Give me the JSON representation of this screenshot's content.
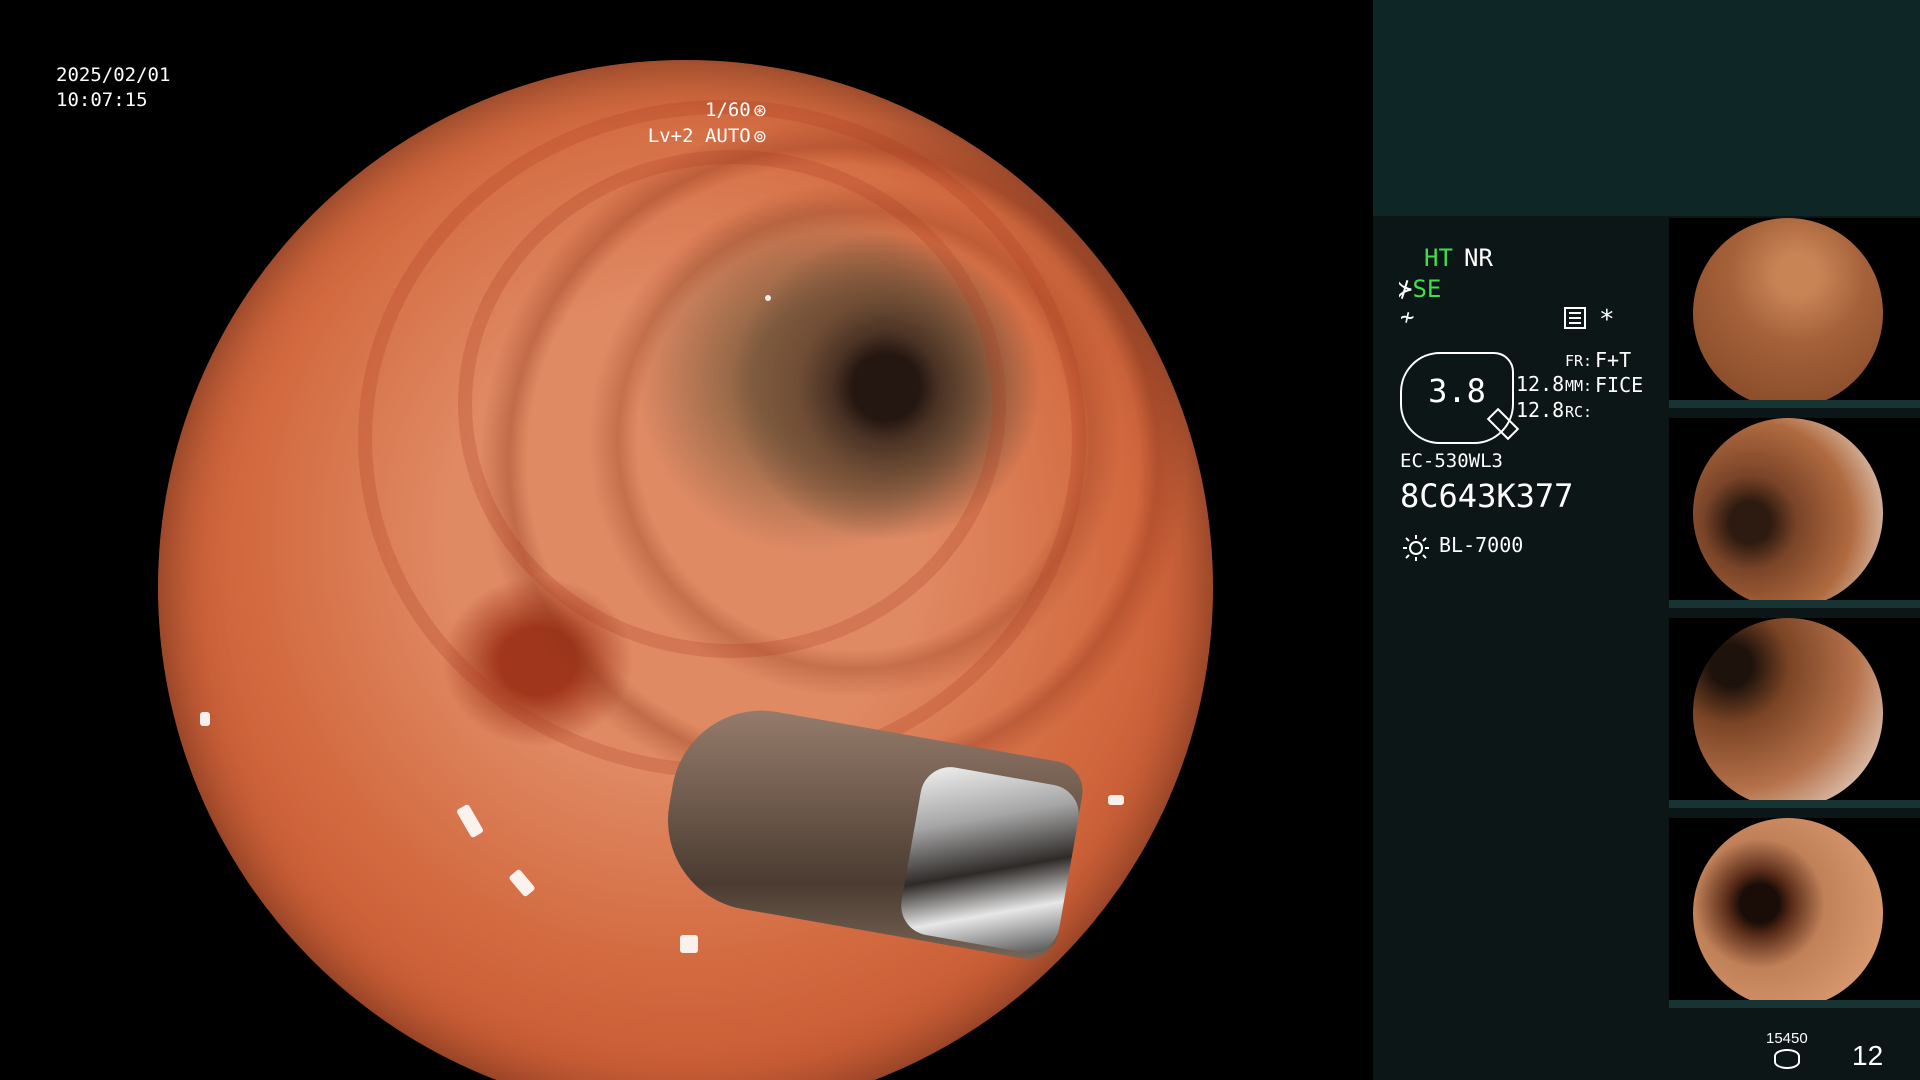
{
  "overlay": {
    "date": "2025/02/01",
    "time": "10:07:15",
    "shutter": "1/60",
    "shutter_icon": "aperture-icon",
    "iris": "Lv+2 AUTO",
    "iris_icon": "iris-icon"
  },
  "panel": {
    "ht": "HT",
    "nr": "NR",
    "se": "SE",
    "menu_icon": "settings-icon",
    "asterisk": "*",
    "zoom": "3.8",
    "value_1": "12.8",
    "value_2": "12.8",
    "fr_label": "FR:",
    "fr_value": "F+T",
    "mm_label": "MM:",
    "mm_value": "FICE",
    "rc_label": "RC:",
    "scope_model": "EC-530WL3",
    "scope_serial": "8C643K377",
    "light_source": "BL-7000",
    "light_icon": "lamp-icon",
    "storage_count": "15450",
    "storage_icon": "database-icon",
    "image_count": "12"
  },
  "colors": {
    "accent_green": "#3fe04e",
    "panel_bg": "#0c1616",
    "panel_top": "#0f2626"
  }
}
